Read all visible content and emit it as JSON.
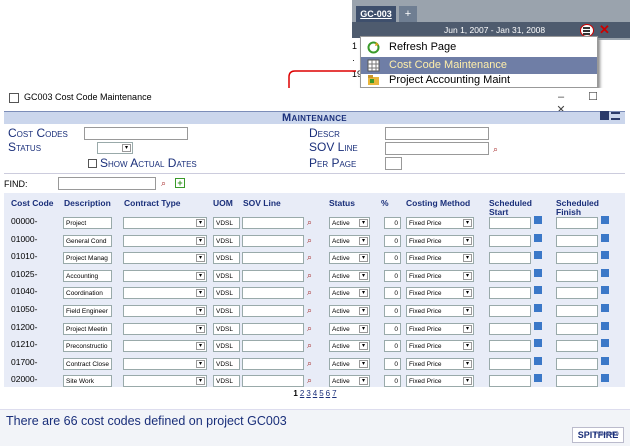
{
  "app_fragment": {
    "tab_active": "GC-003",
    "tab_add": "+",
    "date_range": "Jun 1, 2007 - Jan 31, 2008",
    "menu": [
      {
        "label": "Refresh Page",
        "icon": "refresh-icon"
      },
      {
        "label": "Cost Code Maintenance",
        "icon": "grid-icon",
        "selected": true
      },
      {
        "label": "Project Accounting Maint",
        "icon": "folder-icon"
      }
    ],
    "left_peek": [
      "1",
      "·",
      "19"
    ]
  },
  "window": {
    "title": "GC003 Cost Code Maintenance",
    "minimize": "–",
    "maximize": "☐",
    "close": "✕"
  },
  "maintenance": {
    "header": "Maintenance",
    "filters": {
      "cost_codes": "Cost Codes",
      "status": "Status",
      "show_actual_dates": "Show Actual Dates",
      "descr": "Descr",
      "sov_line": "SOV Line",
      "per_page": "Per Page"
    },
    "find_label": "FIND:"
  },
  "grid": {
    "headers": [
      "Cost Code",
      "Description",
      "Contract Type",
      "UOM",
      "SOV Line",
      "Status",
      "%",
      "Costing Method",
      "Scheduled Start",
      "Scheduled Finish"
    ],
    "rows": [
      {
        "code": "00000-",
        "desc": "Project",
        "uom": "VDSL",
        "status": "Active",
        "pct": "0",
        "method": "Fixed Price"
      },
      {
        "code": "01000-",
        "desc": "General Cond",
        "uom": "VDSL",
        "status": "Active",
        "pct": "0",
        "method": "Fixed Price"
      },
      {
        "code": "01010-",
        "desc": "Project Manag",
        "uom": "VDSL",
        "status": "Active",
        "pct": "0",
        "method": "Fixed Price"
      },
      {
        "code": "01025-",
        "desc": "Accounting",
        "uom": "VDSL",
        "status": "Active",
        "pct": "0",
        "method": "Fixed Price"
      },
      {
        "code": "01040-",
        "desc": "Coordination",
        "uom": "VDSL",
        "status": "Active",
        "pct": "0",
        "method": "Fixed Price"
      },
      {
        "code": "01050-",
        "desc": "Field Engineer",
        "uom": "VDSL",
        "status": "Active",
        "pct": "0",
        "method": "Fixed Price"
      },
      {
        "code": "01200-",
        "desc": "Project Meetin",
        "uom": "VDSL",
        "status": "Active",
        "pct": "0",
        "method": "Fixed Price"
      },
      {
        "code": "01210-",
        "desc": "Preconstructio",
        "uom": "VDSL",
        "status": "Active",
        "pct": "0",
        "method": "Fixed Price"
      },
      {
        "code": "01700-",
        "desc": "Contract Close",
        "uom": "VDSL",
        "status": "Active",
        "pct": "0",
        "method": "Fixed Price"
      },
      {
        "code": "02000-",
        "desc": "Site Work",
        "uom": "VDSL",
        "status": "Active",
        "pct": "0",
        "method": "Fixed Price"
      }
    ],
    "pages": [
      "1",
      "2",
      "3",
      "4",
      "5",
      "6",
      "7"
    ]
  },
  "footer": {
    "message": "There are 66 cost codes defined on project GC003",
    "powered_small": "Powered by",
    "powered_brand": "SPITFIRE"
  }
}
